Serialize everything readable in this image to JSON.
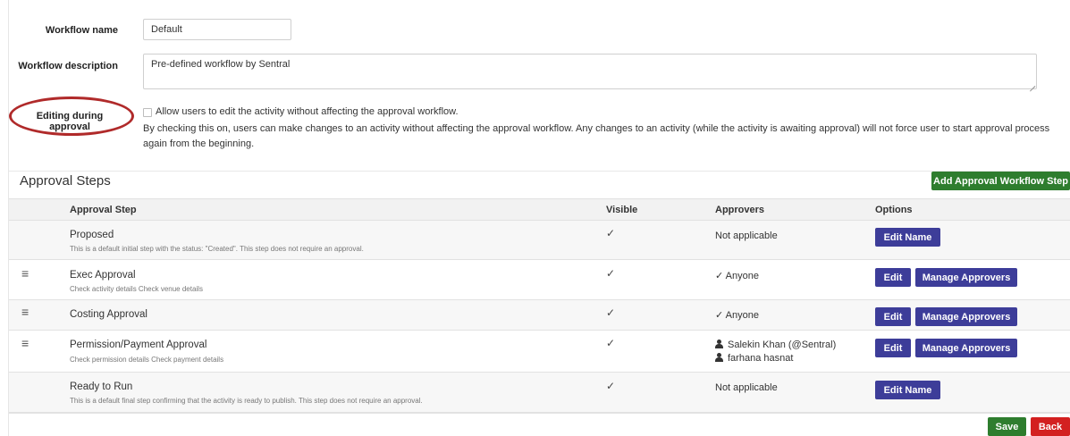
{
  "form": {
    "workflow_name_label": "Workflow name",
    "workflow_name_value": "Default",
    "workflow_description_label": "Workflow description",
    "workflow_description_value": "Pre-defined workflow by Sentral",
    "editing_label": "Editing during approval",
    "editing_checkbox_label": "Allow users to edit the activity without affecting the approval workflow.",
    "editing_checked": false,
    "editing_help_text": "By checking this on, users can make changes to an activity without affecting the approval workflow. Any changes to an activity (while the activity is awaiting approval) will not force user to start approval process again from the beginning."
  },
  "approval_steps": {
    "title": "Approval Steps",
    "add_button_label": "Add Approval Workflow Step",
    "columns": {
      "step": "Approval Step",
      "visible": "Visible",
      "approvers": "Approvers",
      "options": "Options"
    },
    "rows": [
      {
        "name": "Proposed",
        "description": "This is a default initial step with the status: \"Created\". This step does not require an approval.",
        "visible": "✓",
        "approvers": "Not applicable",
        "edit_name_label": "Edit Name"
      },
      {
        "name": "Exec Approval",
        "description": "Check activity details Check venue details",
        "visible": "✓",
        "approvers": "✓ Anyone",
        "edit_label": "Edit",
        "manage_label": "Manage Approvers"
      },
      {
        "name": "Costing Approval",
        "description": "",
        "visible": "✓",
        "approvers": "✓ Anyone",
        "edit_label": "Edit",
        "manage_label": "Manage Approvers"
      },
      {
        "name": "Permission/Payment Approval",
        "description": "Check permission details Check payment details",
        "visible": "✓",
        "approvers_list": [
          "Salekin Khan (@Sentral)",
          "farhana hasnat"
        ],
        "edit_label": "Edit",
        "manage_label": "Manage Approvers"
      },
      {
        "name": "Ready to Run",
        "description": "This is a default final step confirming that the activity is ready to publish. This step does not require an approval.",
        "visible": "✓",
        "approvers": "Not applicable",
        "edit_name_label": "Edit Name"
      }
    ]
  },
  "footer": {
    "save_label": "Save",
    "back_label": "Back"
  },
  "icons": {
    "drag": "drag-handle-icon",
    "person": "person-icon",
    "check": "checkmark-icon"
  },
  "colors": {
    "green": "#2e7d2e",
    "blue": "#3d3d99",
    "red": "#d32020",
    "highlight": "#b02a2a"
  }
}
